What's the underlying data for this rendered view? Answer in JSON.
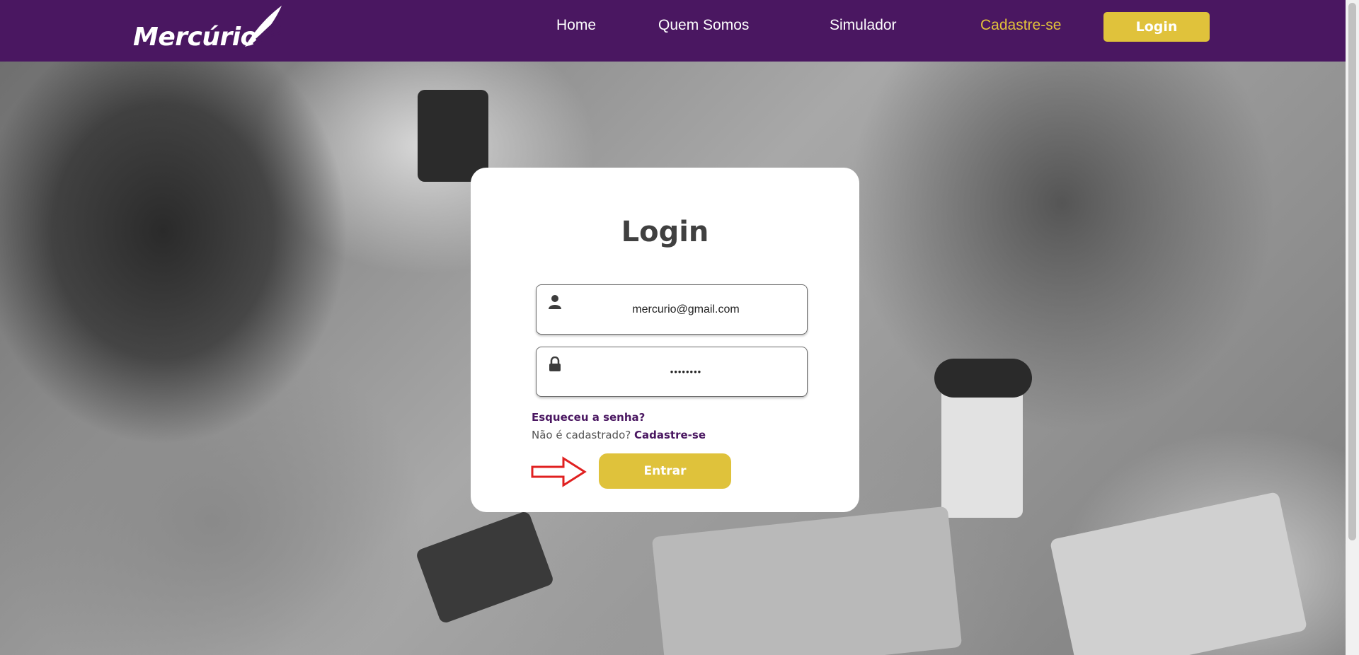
{
  "brand": {
    "name": "Mercúrio"
  },
  "nav": {
    "items": [
      {
        "label": "Home"
      },
      {
        "label": "Quem Somos"
      },
      {
        "label": "Simulador"
      },
      {
        "label": "Cadastre-se"
      }
    ],
    "login_button": "Login"
  },
  "login_card": {
    "title": "Login",
    "email_value": "mercurio@gmail.com",
    "password_value": "••••••••",
    "forgot_link": "Esqueceu a senha?",
    "register_prompt": "Não é cadastrado?",
    "register_link": "Cadastre-se",
    "submit_button": "Entrar"
  },
  "colors": {
    "brand_purple": "#4a1761",
    "accent_gold": "#e0c23b",
    "arrow_red": "#e02020"
  }
}
